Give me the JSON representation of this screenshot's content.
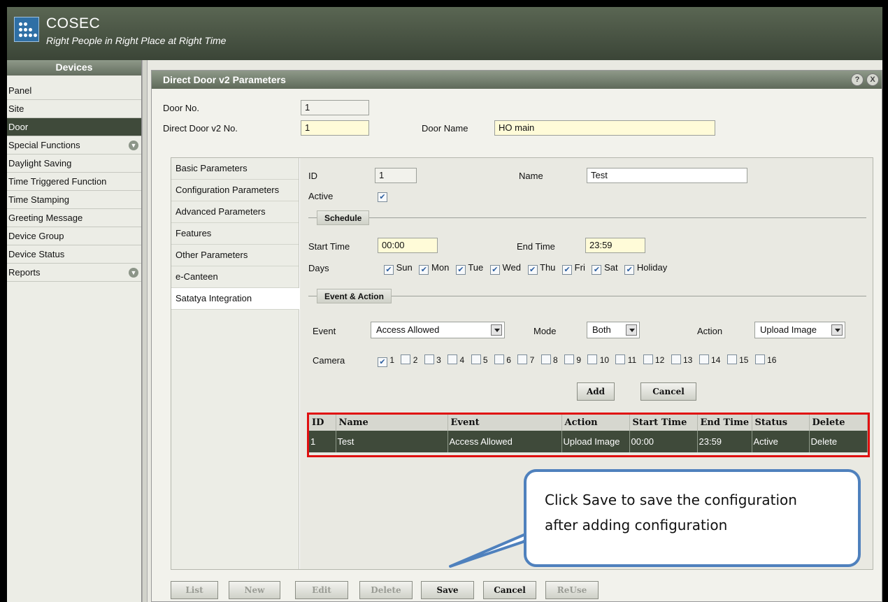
{
  "app": {
    "name": "COSEC",
    "tagline": "Right People in Right Place at Right Time"
  },
  "sidebar": {
    "title": "Devices",
    "items": [
      {
        "label": "Panel"
      },
      {
        "label": "Site"
      },
      {
        "label": "Door",
        "selected": true
      },
      {
        "label": "Special Functions",
        "expandable": true
      },
      {
        "label": "Daylight Saving"
      },
      {
        "label": "Time Triggered Function"
      },
      {
        "label": "Time Stamping"
      },
      {
        "label": "Greeting Message"
      },
      {
        "label": "Device Group"
      },
      {
        "label": "Device Status"
      },
      {
        "label": "Reports",
        "expandable": true
      }
    ]
  },
  "panel": {
    "title": "Direct Door v2 Parameters",
    "help_icon": "?",
    "close_icon": "X",
    "door_no_label": "Door No.",
    "door_no_value": "1",
    "direct_door_no_label": "Direct Door v2 No.",
    "direct_door_no_value": "1",
    "door_name_label": "Door Name",
    "door_name_value": "HO main"
  },
  "tabs": [
    {
      "label": "Basic Parameters"
    },
    {
      "label": "Configuration Parameters"
    },
    {
      "label": "Advanced Parameters"
    },
    {
      "label": "Features"
    },
    {
      "label": "Other Parameters"
    },
    {
      "label": "e-Canteen"
    },
    {
      "label": "Satatya Integration",
      "active": true
    }
  ],
  "form": {
    "id_label": "ID",
    "id_value": "1",
    "name_label": "Name",
    "name_value": "Test",
    "active_label": "Active",
    "active_checked": true,
    "schedule_title": "Schedule",
    "start_time_label": "Start Time",
    "start_time_value": "00:00",
    "end_time_label": "End Time",
    "end_time_value": "23:59",
    "days_label": "Days",
    "days": [
      "Sun",
      "Mon",
      "Tue",
      "Wed",
      "Thu",
      "Fri",
      "Sat",
      "Holiday"
    ],
    "event_action_title": "Event & Action",
    "event_label": "Event",
    "event_value": "Access Allowed",
    "mode_label": "Mode",
    "mode_value": "Both",
    "action_label": "Action",
    "action_value": "Upload Image",
    "camera_label": "Camera",
    "cameras": [
      "1",
      "2",
      "3",
      "4",
      "5",
      "6",
      "7",
      "8",
      "9",
      "10",
      "11",
      "12",
      "13",
      "14",
      "15",
      "16"
    ],
    "camera_checked": [
      "1"
    ],
    "add_label": "Add",
    "cancel_label": "Cancel"
  },
  "table": {
    "columns": [
      "ID",
      "Name",
      "Event",
      "Action",
      "Start Time",
      "End Time",
      "Status",
      "Delete"
    ],
    "rows": [
      [
        "1",
        "Test",
        "Access Allowed",
        "Upload Image",
        "00:00",
        "23:59",
        "Active",
        "Delete"
      ]
    ]
  },
  "footer": {
    "list": "List",
    "new": "New",
    "edit": "Edit",
    "delete": "Delete",
    "save": "Save",
    "cancel": "Cancel",
    "reuse": "ReUse"
  },
  "callout": {
    "line1": "Click Save to save the configuration",
    "line2": "after adding configuration"
  },
  "colors": {
    "header": "#3b4537",
    "selected": "#3f4a3a",
    "highlight_border": "#e01010",
    "callout_border": "#4f81bd",
    "input_yellow": "#fffbd8"
  }
}
